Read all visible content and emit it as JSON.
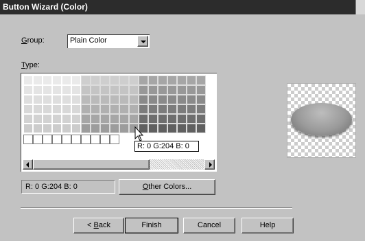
{
  "window": {
    "title": "Button Wizard (Color)"
  },
  "group": {
    "label_accel": "G",
    "label_rest": "roup:",
    "value": "Plain Color"
  },
  "type": {
    "label_accel": "T",
    "label_rest": "ype:"
  },
  "tooltip": "R: 0 G:204 B: 0",
  "status": "R: 0 G:204 B: 0",
  "buttons": {
    "other_accel": "O",
    "other_rest": "ther Colors...",
    "back_prefix": "< ",
    "back_accel": "B",
    "back_rest": "ack",
    "finish": "Finish",
    "cancel": "Cancel",
    "help": "Help"
  }
}
